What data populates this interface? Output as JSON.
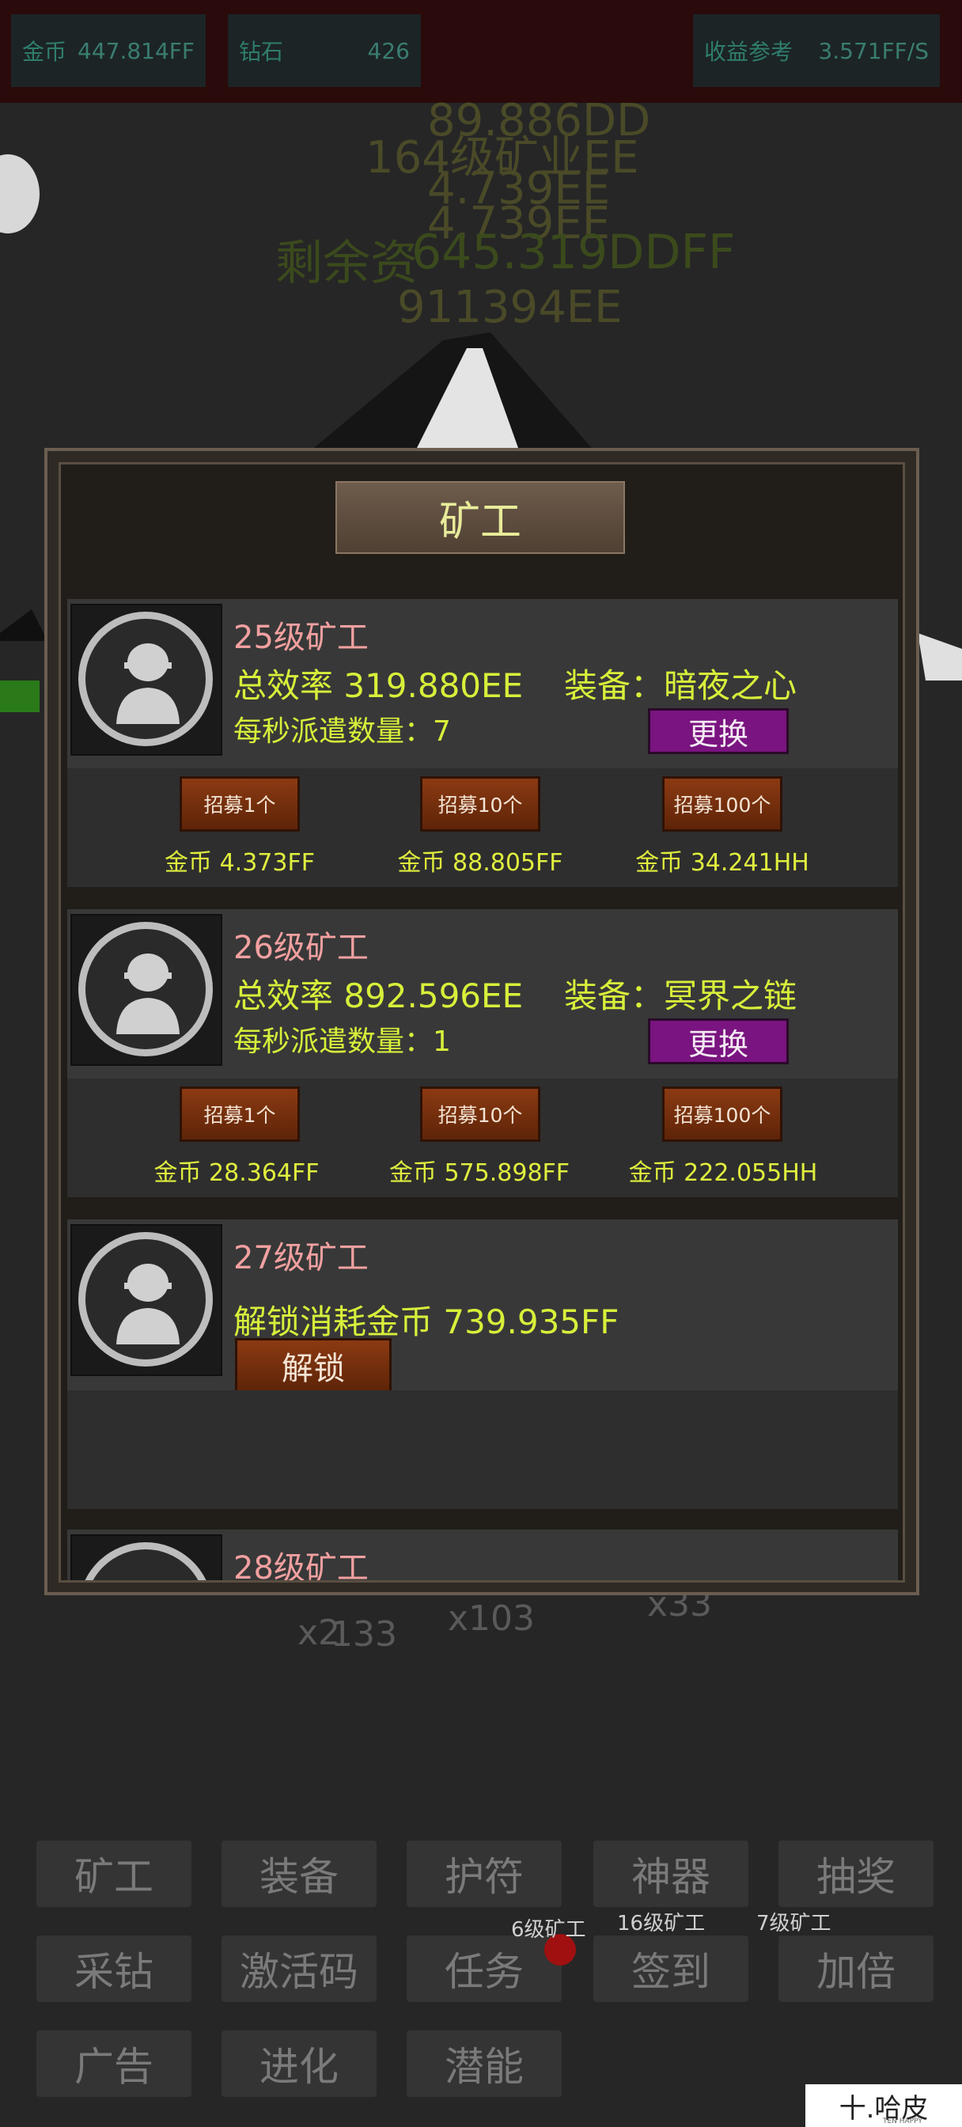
{
  "top": {
    "gold_label": "金币",
    "gold_value": "447.814FF",
    "diamond_label": "钻石",
    "diamond_value": "426",
    "income_label": "收益参考",
    "income_value": "3.571FF/S"
  },
  "background": {
    "floating": [
      "89.886DD",
      "164级矿业EE",
      "4.739EE",
      "4.739EE",
      "剩余资",
      "645.319DDFF",
      "911394EE"
    ],
    "counters": [
      "x2",
      "133",
      "x103",
      "x33"
    ],
    "mini_labels": [
      "6级矿工",
      "16级矿工",
      "7级矿工"
    ]
  },
  "modal": {
    "title": "矿工",
    "miners": [
      {
        "level": "25级矿工",
        "efficiency": "总效率 319.880EE",
        "equip": "装备：暗夜之心",
        "dispatch": "每秒派遣数量：7",
        "swap_label": "更换",
        "hires": [
          {
            "label": "招募1个",
            "cost": "金币 4.373FF"
          },
          {
            "label": "招募10个",
            "cost": "金币 88.805FF"
          },
          {
            "label": "招募100个",
            "cost": "金币 34.241HH"
          }
        ]
      },
      {
        "level": "26级矿工",
        "efficiency": "总效率 892.596EE",
        "equip": "装备：冥界之链",
        "dispatch": "每秒派遣数量：1",
        "swap_label": "更换",
        "hires": [
          {
            "label": "招募1个",
            "cost": "金币 28.364FF"
          },
          {
            "label": "招募10个",
            "cost": "金币 575.898FF"
          },
          {
            "label": "招募100个",
            "cost": "金币 222.055HH"
          }
        ]
      }
    ],
    "locked": {
      "level": "27级矿工",
      "cost": "解锁消耗金币 739.935FF",
      "unlock_label": "解锁"
    },
    "next": {
      "level": "28级矿工"
    }
  },
  "nav": {
    "row1": [
      "矿工",
      "装备",
      "护符",
      "神器",
      "抽奖"
    ],
    "row2": [
      "采钻",
      "激活码",
      "任务",
      "签到",
      "加倍"
    ],
    "row3": [
      "广告",
      "进化",
      "潜能"
    ]
  },
  "watermark": {
    "text": "十.哈皮",
    "sub": "TEN HAPPY"
  },
  "colors": {
    "accent": "#d8ef3a",
    "level": "#f2a0a0",
    "swap": "#7a1480",
    "hire": "#8b3a12"
  }
}
